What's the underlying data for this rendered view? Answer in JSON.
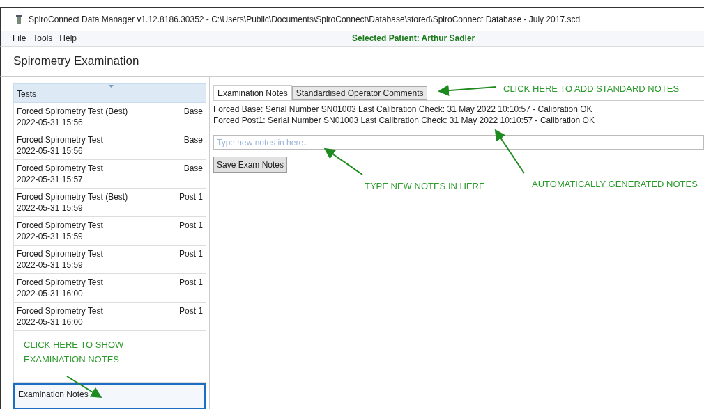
{
  "window": {
    "title": "SpiroConnect Data Manager v1.12.8186.30352 - C:\\Users\\Public\\Documents\\SpiroConnect\\Database\\stored\\SpiroConnect Database - July 2017.scd"
  },
  "menu": [
    "File",
    "Tools",
    "Help"
  ],
  "selected_patient": "Selected Patient: Arthur Sadler",
  "page_title": "Spirometry Examination",
  "tests": {
    "header": "Tests",
    "items": [
      {
        "name": "Forced Spirometry Test (Best)",
        "date": "2022-05-31 15:56",
        "stage": "Base"
      },
      {
        "name": "Forced Spirometry Test",
        "date": "2022-05-31 15:56",
        "stage": "Base"
      },
      {
        "name": "Forced Spirometry Test",
        "date": "2022-05-31 15:57",
        "stage": "Base"
      },
      {
        "name": "Forced Spirometry Test (Best)",
        "date": "2022-05-31 15:59",
        "stage": "Post 1"
      },
      {
        "name": "Forced Spirometry Test",
        "date": "2022-05-31 15:59",
        "stage": "Post 1"
      },
      {
        "name": "Forced Spirometry Test",
        "date": "2022-05-31 15:59",
        "stage": "Post 1"
      },
      {
        "name": "Forced Spirometry Test",
        "date": "2022-05-31 16:00",
        "stage": "Post 1"
      },
      {
        "name": "Forced Spirometry Test",
        "date": "2022-05-31 16:00",
        "stage": "Post 1"
      }
    ]
  },
  "notes_item": {
    "label": "Examination Notes",
    "selected": true
  },
  "tabs": [
    {
      "label": "Examination Notes",
      "selected": true
    },
    {
      "label": "Standardised Operator Comments",
      "selected": false
    }
  ],
  "notes": [
    "Forced Base: Serial Number SN01003 Last Calibration Check: 31 May 2022 10:10:57 - Calibration OK",
    "Forced Post1: Serial Number SN01003 Last Calibration Check: 31 May 2022 10:10:57 - Calibration OK"
  ],
  "new_note": {
    "placeholder": "Type new notes in here.."
  },
  "save_button": "Save Exam Notes",
  "annotations": [
    "CLICK HERE TO ADD STANDARD NOTES",
    "TYPE NEW NOTES IN HERE",
    "AUTOMATICALLY GENERATED NOTES",
    "CLICK HERE TO SHOW EXAMINATION NOTES"
  ]
}
